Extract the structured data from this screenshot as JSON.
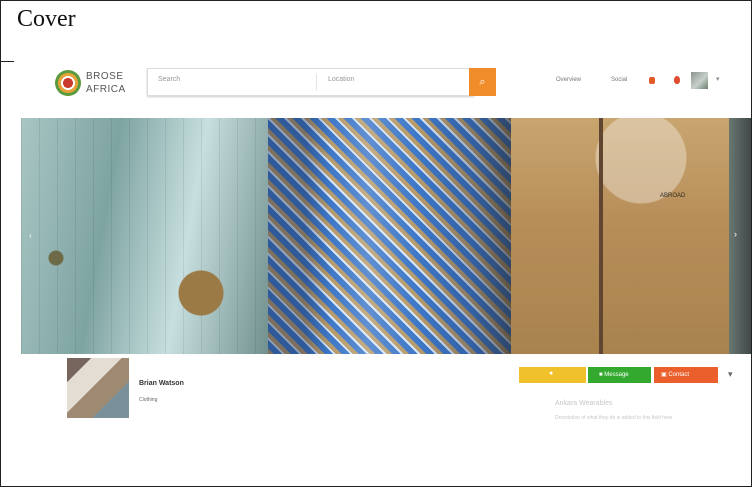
{
  "page": {
    "title": "Cover"
  },
  "brand": {
    "line1": "BROSE",
    "line2": "AFRICA"
  },
  "search": {
    "placeholder": "Search",
    "location": "Location"
  },
  "nav": {
    "link1": "Overview",
    "link2": "Social"
  },
  "banner": {
    "caption": "ABROAD"
  },
  "profile": {
    "name": "Brian Watson",
    "subtitle": "Clothing"
  },
  "actions": {
    "message": "Message",
    "contact": "Contact"
  },
  "about": {
    "title": "Ankara Wearables",
    "text": "Description of what they do is added to this field here"
  },
  "colors": {
    "accent": "#f08c2a",
    "follow": "#f0c12b",
    "message": "#33aa2f",
    "contact": "#ea5f2c"
  }
}
